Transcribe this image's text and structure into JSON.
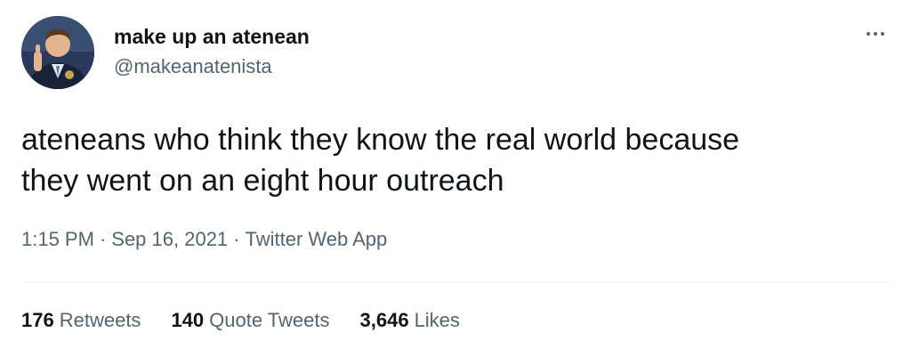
{
  "user": {
    "display_name": "make up an atenean",
    "handle": "@makeanatenista"
  },
  "tweet": {
    "text_lines": [
      "ateneans who think they know the real world because",
      "they went on an eight hour outreach"
    ],
    "time": "1:15 PM",
    "date": "Sep 16, 2021",
    "source": "Twitter Web App",
    "separator": "·"
  },
  "stats": {
    "retweets": {
      "count": "176",
      "label": "Retweets"
    },
    "quote_tweets": {
      "count": "140",
      "label": "Quote Tweets"
    },
    "likes": {
      "count": "3,646",
      "label": "Likes"
    }
  },
  "icons": {
    "more": "more-options-icon"
  },
  "colors": {
    "text_primary": "#0f1419",
    "text_secondary": "#536471",
    "divider": "#eff3f4"
  }
}
